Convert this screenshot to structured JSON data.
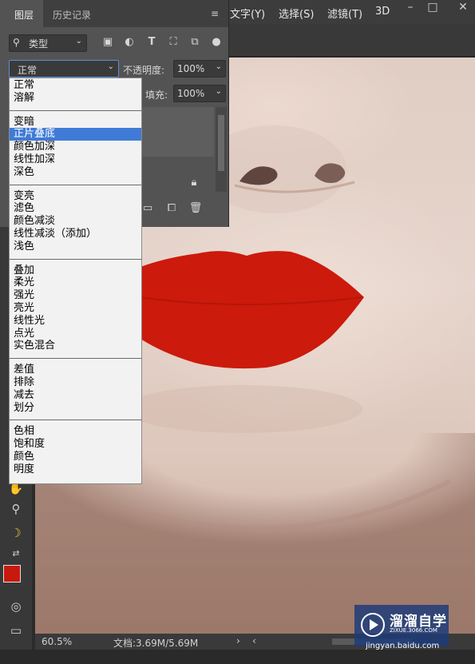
{
  "menu": {
    "items": [
      "文字(Y)",
      "选择(S)",
      "滤镜(T)",
      "3D"
    ]
  },
  "layers_panel": {
    "tabs": [
      "图层",
      "历史记录"
    ],
    "filter_label": "类型",
    "blend_mode": "正常",
    "opacity_label": "不透明度:",
    "opacity_value": "100%",
    "fill_label": "填充:",
    "fill_value": "100%"
  },
  "blend_menu": {
    "groups": [
      [
        "正常",
        "溶解"
      ],
      [
        "变暗",
        "正片叠底",
        "颜色加深",
        "线性加深",
        "深色"
      ],
      [
        "变亮",
        "滤色",
        "颜色减淡",
        "线性减淡（添加）",
        "浅色"
      ],
      [
        "叠加",
        "柔光",
        "强光",
        "亮光",
        "线性光",
        "点光",
        "实色混合"
      ],
      [
        "差值",
        "排除",
        "减去",
        "划分"
      ],
      [
        "色相",
        "饱和度",
        "颜色",
        "明度"
      ]
    ],
    "selected": "正片叠底"
  },
  "status": {
    "zoom": "60.5%",
    "doc": "文档:3.69M/5.69M"
  },
  "watermark": {
    "brand": "溜溜自学",
    "domain": "ZIXUE.3066.COM",
    "source": "jingyan.baidu.com"
  },
  "colors": {
    "lip_red": "#cc1a0c",
    "foreground_swatch": "#c8190e",
    "selection_blue": "#3f7bd6"
  }
}
